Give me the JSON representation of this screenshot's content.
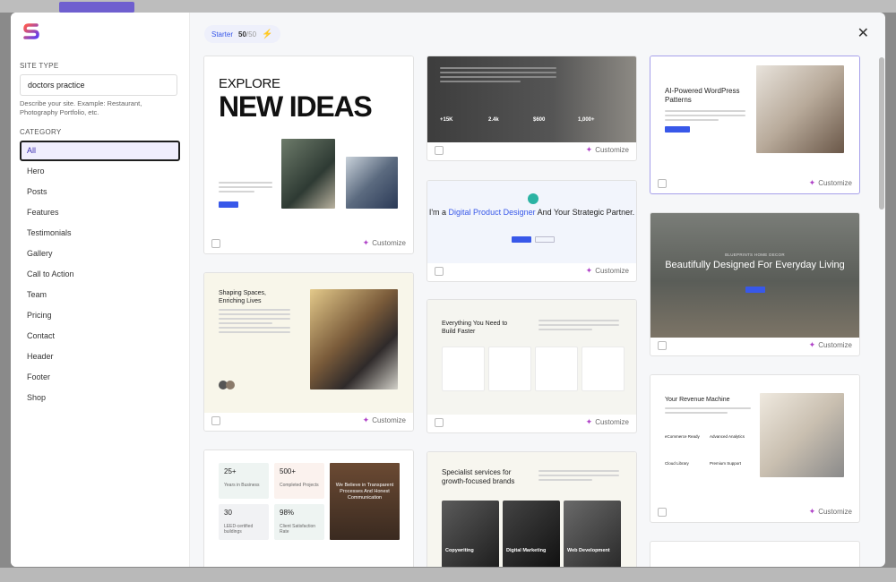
{
  "sidebar": {
    "site_type_label": "SITE TYPE",
    "site_type_value": "doctors practice",
    "hint": "Describe your site. Example: Restaurant, Photography Portfolio, etc.",
    "category_label": "CATEGORY",
    "categories": [
      "All",
      "Hero",
      "Posts",
      "Features",
      "Testimonials",
      "Gallery",
      "Call to Action",
      "Team",
      "Pricing",
      "Contact",
      "Header",
      "Footer",
      "Shop"
    ]
  },
  "topbar": {
    "plan": "Starter",
    "count": "50",
    "max": "/50"
  },
  "card_action": "Customize",
  "thumbs": {
    "explore_line1": "EXPLORE",
    "explore_line2": "NEW IDEAS",
    "dark_stats": [
      "+15K",
      "2.4k",
      "$600",
      "1,000+"
    ],
    "ai_title": "AI-Powered WordPress Patterns",
    "designer_pre": "I'm a ",
    "designer_hl": "Digital Product Designer",
    "designer_post": " And Your Strategic Partner.",
    "living_caption": "BLUEPRINTS HOME DECOR",
    "living_title": "Beautifully Designed For Everyday Living",
    "shaping_title": "Shaping Spaces, Enriching Lives",
    "features_title": "Everything You Need to Build Faster",
    "revenue_title": "Your Revenue Machine",
    "revenue_items": [
      "eCommerce Ready",
      "Advanced Analytics",
      "Cloud Library",
      "Premium Support"
    ],
    "stats": [
      {
        "v": "25+",
        "l": "Years in Business"
      },
      {
        "v": "500+",
        "l": "Completed Projects"
      },
      {
        "v": "30",
        "l": "LEED-certified buildings"
      },
      {
        "v": "98%",
        "l": "Client Satisfaction Rate"
      }
    ],
    "stats_right_title": "We Believe in Transparent Processes And Honest Communication",
    "special_title": "Specialist services for growth-focused brands",
    "special_services": [
      "Copywriting",
      "Digital Marketing",
      "Web Development"
    ]
  },
  "colors": {
    "accent": "#3858e9",
    "customize_icon": "#b044c8",
    "selected_border": "#a6a0ea"
  }
}
